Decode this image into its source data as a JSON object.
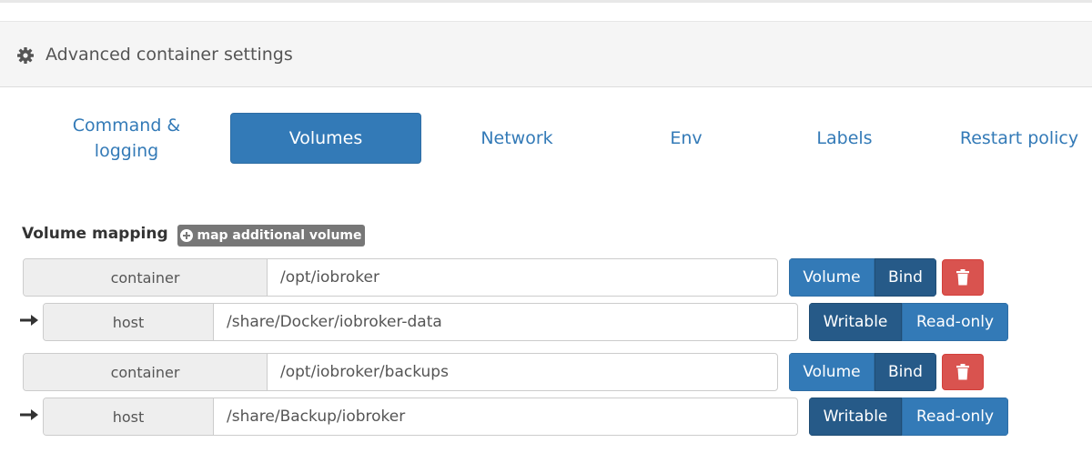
{
  "panel": {
    "title": "Advanced container settings",
    "icon": "gear-icon"
  },
  "tabs": [
    {
      "label": "Command & logging",
      "active": false
    },
    {
      "label": "Volumes",
      "active": true
    },
    {
      "label": "Network",
      "active": false
    },
    {
      "label": "Env",
      "active": false
    },
    {
      "label": "Labels",
      "active": false
    },
    {
      "label": "Restart policy",
      "active": false
    }
  ],
  "volumes": {
    "section_label": "Volume mapping",
    "add_button_label": "map additional volume",
    "mappings": [
      {
        "container_label": "container",
        "container_path": "/opt/iobroker",
        "type_options": [
          "Volume",
          "Bind"
        ],
        "type_selected": "Bind",
        "host_label": "host",
        "host_path": "/share/Docker/iobroker-data",
        "mode_options": [
          "Writable",
          "Read-only"
        ],
        "mode_selected": "Writable"
      },
      {
        "container_label": "container",
        "container_path": "/opt/iobroker/backups",
        "type_options": [
          "Volume",
          "Bind"
        ],
        "type_selected": "Bind",
        "host_label": "host",
        "host_path": "/share/Backup/iobroker",
        "mode_options": [
          "Writable",
          "Read-only"
        ],
        "mode_selected": "Writable"
      }
    ]
  },
  "colors": {
    "primary": "#337ab7",
    "primary_active": "#265a88",
    "danger": "#d9534f",
    "default_badge": "#777777"
  }
}
